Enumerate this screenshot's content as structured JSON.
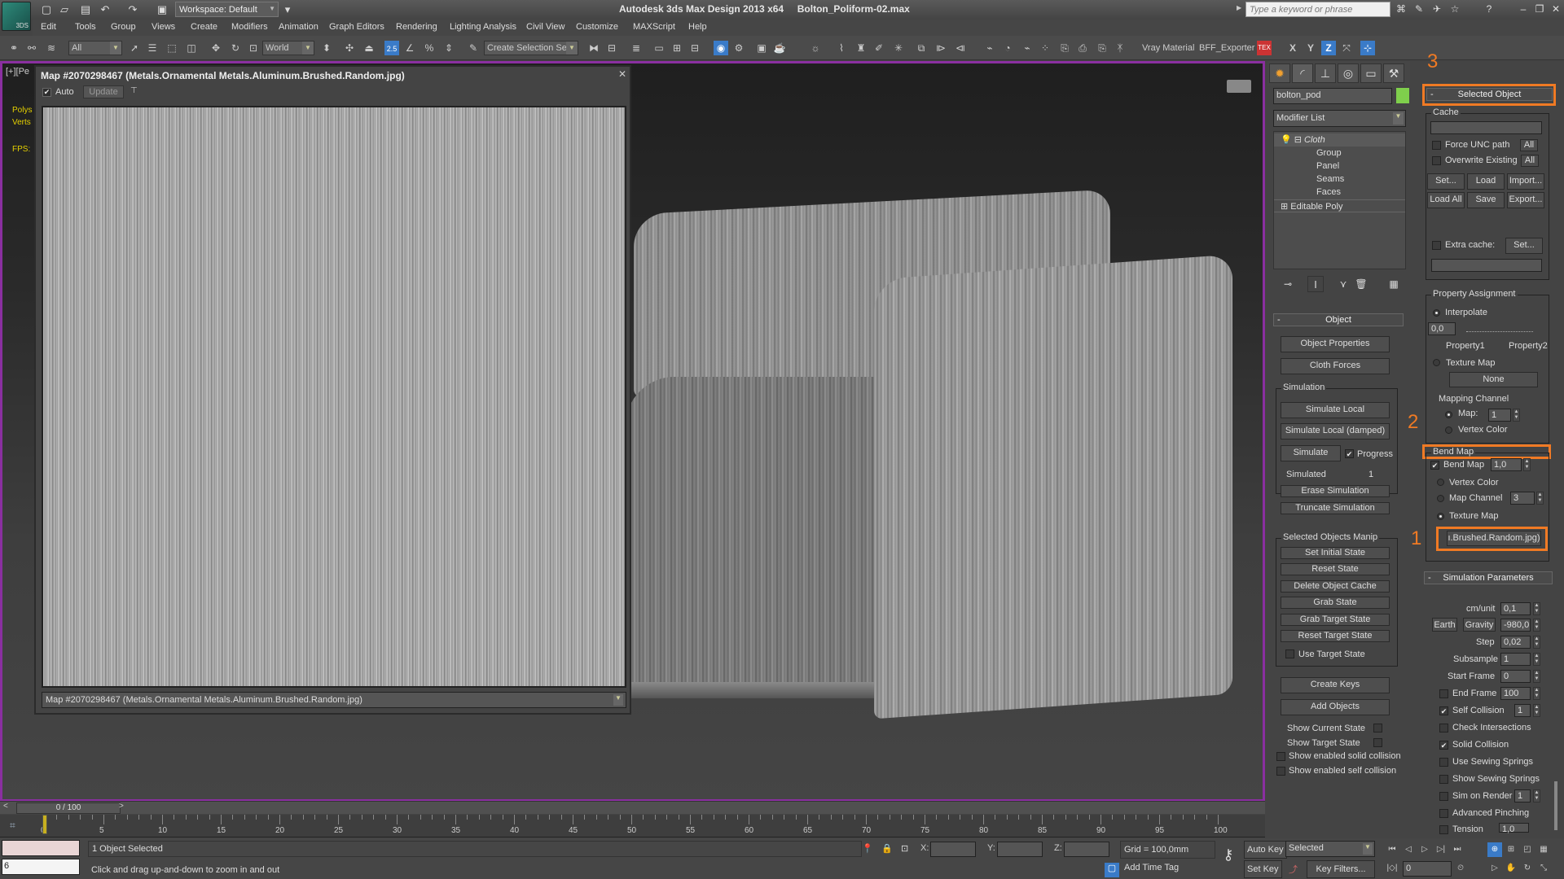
{
  "app": {
    "title": "Autodesk 3ds Max Design 2013 x64",
    "file": "Bolton_Poliform-02.max",
    "logo_label": "3DS",
    "workspace": "Workspace: Default",
    "search_placeholder": "Type a keyword or phrase"
  },
  "menu": [
    "Edit",
    "Tools",
    "Group",
    "Views",
    "Create",
    "Modifiers",
    "Animation",
    "Graph Editors",
    "Rendering",
    "Lighting Analysis",
    "Civil View",
    "Customize",
    "MAXScript",
    "Help"
  ],
  "toolbar": {
    "selection_filter": "All",
    "coord_system": "World",
    "snap_label": "2.5",
    "named_selection": "Create Selection Se",
    "vray_material": "Vray Material",
    "bff_exporter": "BFF_Exporter",
    "axis_x": "X",
    "axis_y": "Y",
    "axis_z": "Z"
  },
  "viewport": {
    "label": "[+][Pe",
    "stats_polys": "Polys",
    "stats_verts": "Verts",
    "fps": "FPS:",
    "border_color": "#8a2fa0"
  },
  "map_window": {
    "title": "Map #2070298467 (Metals.Ornamental Metals.Aluminum.Brushed.Random.jpg)",
    "auto_label": "Auto",
    "auto_checked": true,
    "update_label": "Update",
    "footer_value": "Map #2070298467 (Metals.Ornamental Metals.Aluminum.Brushed.Random.jpg)"
  },
  "command_panel": {
    "object_name": "bolton_pod",
    "object_color": "#7fcf4c",
    "modifier_list": "Modifier List",
    "stack": [
      {
        "label": "Cloth",
        "level": 0
      },
      {
        "label": "Group",
        "level": 1
      },
      {
        "label": "Panel",
        "level": 1
      },
      {
        "label": "Seams",
        "level": 1
      },
      {
        "label": "Faces",
        "level": 1
      },
      {
        "label": "Editable Poly",
        "level": 0
      }
    ],
    "object_rollout": {
      "title": "Object",
      "object_properties": "Object Properties",
      "cloth_forces": "Cloth Forces",
      "simulation_group": "Simulation",
      "simulate_local": "Simulate Local",
      "simulate_local_damped": "Simulate Local (damped)",
      "simulate": "Simulate",
      "progress_label": "Progress",
      "progress_checked": true,
      "simulated_label": "Simulated",
      "simulated_value": "1",
      "erase_simulation": "Erase Simulation",
      "truncate_simulation": "Truncate Simulation",
      "manip_group": "Selected Objects Manip",
      "set_initial_state": "Set Initial State",
      "reset_state": "Reset State",
      "delete_object_cache": "Delete Object Cache",
      "grab_state": "Grab State",
      "grab_target_state": "Grab Target State",
      "reset_target_state": "Reset Target State",
      "use_target_state": "Use Target State",
      "create_keys": "Create Keys",
      "add_objects": "Add Objects",
      "show_current_state": "Show Current State",
      "show_target_state": "Show Target State",
      "show_solid_collision": "Show enabled solid collision",
      "show_self_collision": "Show enabled self collision"
    }
  },
  "selected_object_panel": {
    "title": "Selected Object",
    "cache_group": "Cache",
    "force_unc": "Force UNC path",
    "overwrite_existing": "Overwrite Existing",
    "all_label": "All",
    "set": "Set...",
    "load": "Load",
    "import": "Import...",
    "load_all": "Load All",
    "save": "Save",
    "export": "Export...",
    "extra_cache": "Extra cache:",
    "property_group": "Property Assignment",
    "interpolate": "Interpolate",
    "interp_value": "0,0",
    "property1": "Property1",
    "property2": "Property2",
    "texture_map": "Texture Map",
    "none": "None",
    "mapping_channel": "Mapping Channel",
    "map_label": "Map:",
    "map_value": "1",
    "vertex_color": "Vertex Color",
    "bend_group": "Bend Map",
    "bend_map_label": "Bend Map",
    "bend_map_checked": true,
    "bend_value": "1,0",
    "bend_vertex_color": "Vertex Color",
    "bend_map_channel": "Map Channel",
    "bend_map_channel_value": "3",
    "bend_texture_map": "Texture Map",
    "bend_texture_button": "ı.Brushed.Random.jpg)"
  },
  "sim_params": {
    "title": "Simulation Parameters",
    "cm_unit_label": "cm/unit",
    "cm_unit": "0,1",
    "earth": "Earth",
    "gravity": "Gravity",
    "gravity_value": "-980,0",
    "step_label": "Step",
    "step": "0,02",
    "subsample_label": "Subsample",
    "subsample": "1",
    "start_frame_label": "Start Frame",
    "start_frame": "0",
    "end_frame_label": "End Frame",
    "end_frame": "100",
    "self_collision": "Self Collision",
    "self_collision_value": "1",
    "check_intersections": "Check Intersections",
    "solid_collision": "Solid Collision",
    "use_sewing": "Use Sewing Springs",
    "show_sewing": "Show Sewing Springs",
    "sim_on_render": "Sim on Render",
    "sim_on_render_value": "1",
    "advanced_pinching": "Advanced Pinching",
    "tension": "Tension",
    "tension_value": "1,0"
  },
  "annotations": [
    "1",
    "2",
    "3"
  ],
  "timeline": {
    "slider": "0 / 100",
    "ticks": [
      "0",
      "5",
      "10",
      "15",
      "20",
      "25",
      "30",
      "35",
      "40",
      "45",
      "50",
      "55",
      "60",
      "65",
      "70",
      "75",
      "80",
      "85",
      "90",
      "95",
      "100"
    ]
  },
  "status": {
    "selection": "1 Object Selected",
    "prompt": "Click and drag up-and-down to zoom in and out",
    "mini_value": "6",
    "x_label": "X:",
    "y_label": "Y:",
    "z_label": "Z:",
    "grid": "Grid = 100,0mm",
    "add_time_tag": "Add Time Tag",
    "auto_key": "Auto Key",
    "set_key": "Set Key",
    "selected": "Selected",
    "key_filters": "Key Filters...",
    "frame": "0"
  }
}
